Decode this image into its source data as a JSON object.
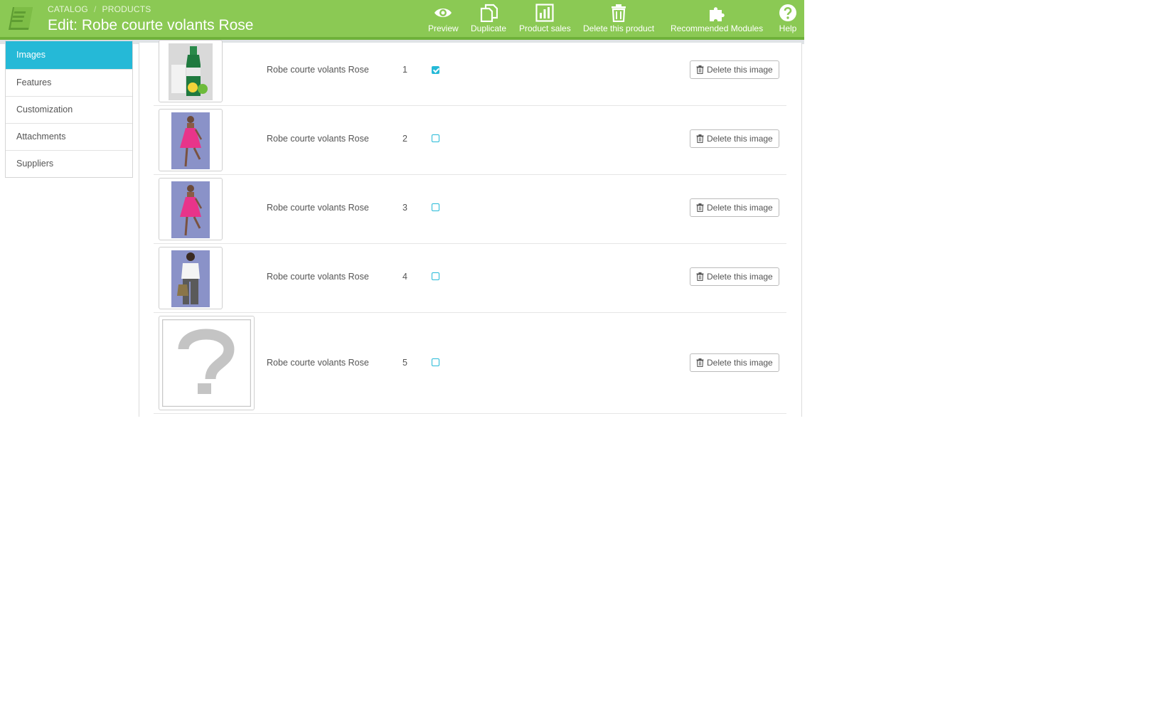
{
  "header": {
    "breadcrumb": [
      "CATALOG",
      "PRODUCTS"
    ],
    "title": "Edit: Robe courte volants Rose",
    "accent_color": "#8bc954",
    "toolbar": [
      {
        "label": "Preview",
        "icon": "eye-icon"
      },
      {
        "label": "Duplicate",
        "icon": "duplicate-icon"
      },
      {
        "label": "Product sales",
        "icon": "bar-chart-icon"
      },
      {
        "label": "Delete this product",
        "icon": "trash-icon"
      },
      {
        "label": "Recommended Modules",
        "icon": "puzzle-icon"
      },
      {
        "label": "Help",
        "icon": "help-icon"
      }
    ]
  },
  "sidebar": {
    "active_color": "#25b9d7",
    "items": [
      {
        "label": "Images",
        "active": true
      },
      {
        "label": "Features",
        "active": false
      },
      {
        "label": "Customization",
        "active": false
      },
      {
        "label": "Attachments",
        "active": false
      },
      {
        "label": "Suppliers",
        "active": false
      }
    ]
  },
  "images": {
    "rows": [
      {
        "legend": "Robe courte volants Rose",
        "position": "1",
        "cover": true,
        "delete_label": "Delete this image",
        "thumb": "bottle-lemon-photo"
      },
      {
        "legend": "Robe courte volants Rose",
        "position": "2",
        "cover": false,
        "delete_label": "Delete this image",
        "thumb": "pink-dress-photo"
      },
      {
        "legend": "Robe courte volants Rose",
        "position": "3",
        "cover": false,
        "delete_label": "Delete this image",
        "thumb": "pink-dress-photo"
      },
      {
        "legend": "Robe courte volants Rose",
        "position": "4",
        "cover": false,
        "delete_label": "Delete this image",
        "thumb": "white-top-photo"
      },
      {
        "legend": "Robe courte volants Rose",
        "position": "5",
        "cover": false,
        "delete_label": "Delete this image",
        "thumb": "placeholder-question-mark"
      }
    ]
  }
}
